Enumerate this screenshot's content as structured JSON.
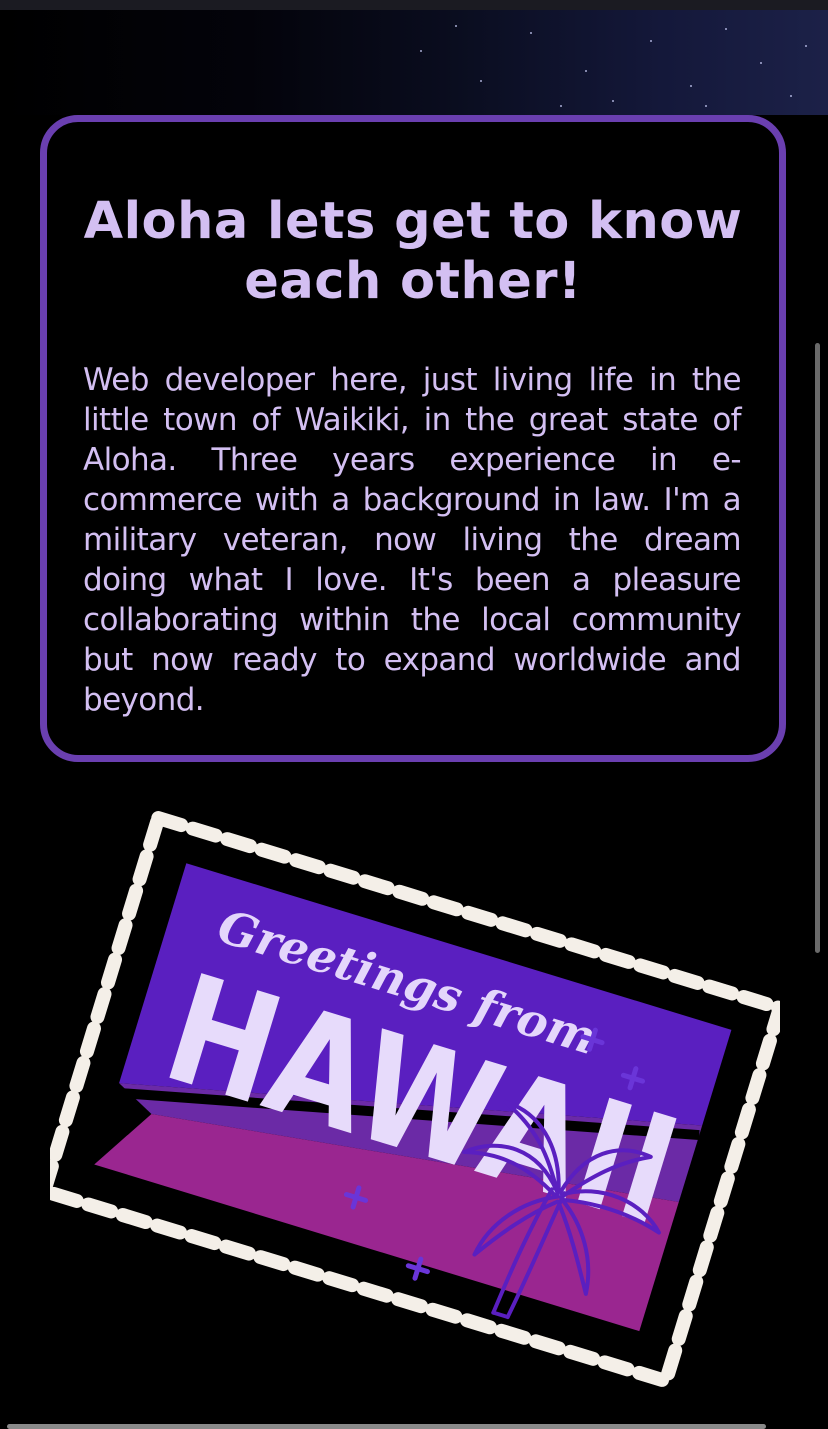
{
  "about": {
    "title": "Aloha lets get to know each other!",
    "body": "Web developer here, just living life in the little town of Waikiki, in the great state of Aloha. Three years experience in e-commerce with a background in law. I'm a military veteran, now living the dream doing what I love. It's been a pleasure collaborating within the local community but now ready to expand worldwide and beyond."
  },
  "postcard": {
    "script_text": "Greetings from",
    "headline": "HAWAII",
    "icons": [
      "palm-tree-icon",
      "sparkle-icon"
    ]
  },
  "colors": {
    "background": "#000000",
    "card_border": "#6a3fb0",
    "text": "#d3bff2",
    "stamp_purple": "#5a1fc0",
    "stamp_violet": "#6b2aa6",
    "stamp_magenta": "#9a2690",
    "stamp_border": "#f4efe8"
  }
}
